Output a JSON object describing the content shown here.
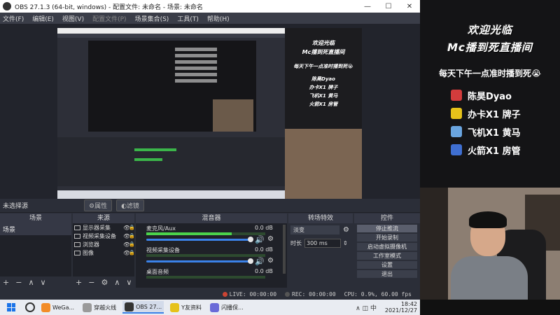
{
  "window": {
    "title": "OBS 27.1.3 (64-bit, windows) - 配置文件: 未命名 - 场景: 未命名",
    "controls": [
      "—",
      "☐",
      "✕"
    ]
  },
  "menu": [
    "文件(F)",
    "编辑(E)",
    "视图(V)",
    "配置文件(P)",
    "场景集合(S)",
    "工具(T)",
    "帮助(H)"
  ],
  "overlay": {
    "title1": "欢迎光临",
    "title2": "Mc播到死直播间",
    "subtitle": "每天下午一点准时播到死😭",
    "items": [
      {
        "label": "陈昊Dyao",
        "color": "#d33c3c"
      },
      {
        "label": "办卡X1 牌子",
        "color": "#e6c21a"
      },
      {
        "label": "飞机X1 黄马",
        "color": "#6aa5e0"
      },
      {
        "label": "火箭X1 房管",
        "color": "#3f6fd1"
      }
    ]
  },
  "scene_bar": {
    "no_source": "未选择源",
    "props_btn": "⚙属性",
    "filters_btn": "◐滤镜"
  },
  "docks": {
    "scenes": {
      "title": "场景",
      "items": [
        "场景"
      ],
      "footer": [
        "+",
        "−",
        "∧",
        "∨"
      ]
    },
    "sources": {
      "title": "来源",
      "items": [
        {
          "label": "显示器采集",
          "eye": "👁",
          "lock": "🔒"
        },
        {
          "label": "视频采集设备",
          "eye": "👁",
          "lock": "🔒"
        },
        {
          "label": "浏览器",
          "eye": "👁",
          "lock": "🔒"
        },
        {
          "label": "图像",
          "eye": "👁",
          "lock": "🔒"
        }
      ],
      "footer": [
        "+",
        "−",
        "⚙",
        "∧",
        "∨"
      ]
    },
    "mixer": {
      "title": "混音器",
      "channels": [
        {
          "name": "麦克风/Aux",
          "db": "0.0 dB",
          "level": 0.72
        },
        {
          "name": "视频采集设备",
          "db": "0.0 dB",
          "level": 0.0
        },
        {
          "name": "桌面音频",
          "db": "0.0 dB",
          "level": 0.0
        }
      ]
    },
    "transitions": {
      "title": "转场特效",
      "selected": "淡变",
      "duration_label": "时长",
      "duration_value": "300 ms"
    },
    "controls": {
      "title": "控件",
      "buttons": [
        "停止推流",
        "开始录制",
        "启动虚拟摄像机",
        "工作室模式",
        "设置",
        "退出"
      ]
    }
  },
  "status": {
    "live": "LIVE: 00:00:00",
    "rec": "REC: 00:00:00",
    "cpu": "CPU: 0.9%, 60.00 fps"
  },
  "taskbar": {
    "apps": [
      {
        "label": "WeGa...",
        "color": "#f28c28"
      },
      {
        "label": "穿越火线",
        "color": "#9a9a9a"
      },
      {
        "label": "OBS 27...",
        "color": "#333333"
      },
      {
        "label": "Y友资料",
        "color": "#e6c21a"
      },
      {
        "label": "闪播保...",
        "color": "#6a6ad8"
      }
    ],
    "tray": "∧ ◫ 中",
    "time": "18:42",
    "date": "2021/12/27"
  }
}
